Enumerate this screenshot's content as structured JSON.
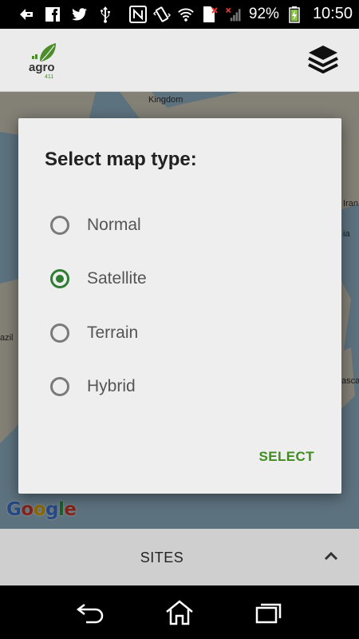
{
  "status_bar": {
    "battery": "92%",
    "time": "10:50"
  },
  "app_bar": {
    "logo_text": "agro",
    "logo_subtext": "411",
    "layers_icon": "layers-icon"
  },
  "map": {
    "labels": {
      "kingdom": "Kingdom",
      "iran": "Iran",
      "ia": "ia",
      "azil": "azil",
      "ascar": "ascar"
    },
    "attribution": "Google"
  },
  "dialog": {
    "title": "Select map type:",
    "options": [
      {
        "label": "Normal",
        "checked": false
      },
      {
        "label": "Satellite",
        "checked": true
      },
      {
        "label": "Terrain",
        "checked": false
      },
      {
        "label": "Hybrid",
        "checked": false
      }
    ],
    "select_label": "SELECT",
    "accent_color": "#2e7d32"
  },
  "bottom_panel": {
    "title": "SITES"
  },
  "nav_bar": {
    "icons": [
      "back-icon",
      "home-icon",
      "recents-icon"
    ]
  }
}
